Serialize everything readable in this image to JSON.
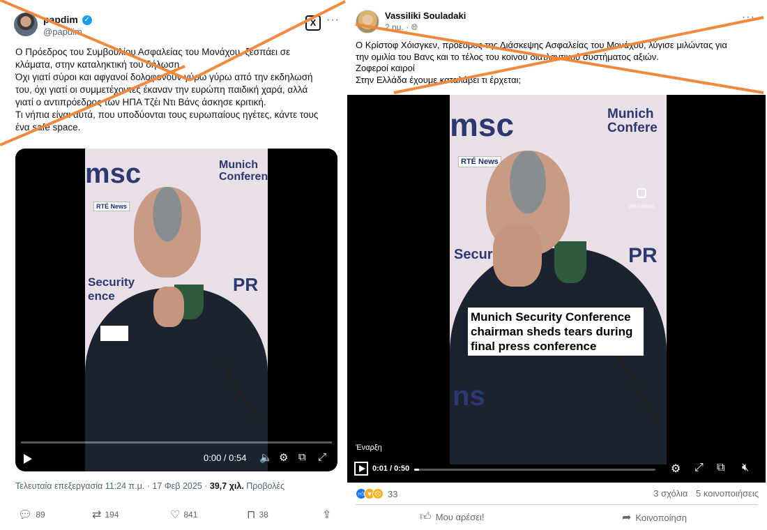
{
  "twitter_post": {
    "display_name": "papdim",
    "handle": "@papdim",
    "grok_label": "X",
    "more_label": "···",
    "text_lines": [
      "Ο Πρόεδρος του Συμβουλίου Ασφαλείας του Μονάχου, ξεσπάει σε",
      "κλάματα, στην καταληκτική του δήλωση.",
      "Όχι γιατί σύροι και αφγανοί δολοφονούν γύρω γύρω από την εκδηλωσή",
      "του, όχι γιατί οι συμμετέχοντες έκαναν την ευρώπη παιδική χαρά, αλλά",
      "γιατί ο αντιπρόεδρος των ΗΠΑ Τζέι Ντι Βάνς άσκησε κριτική.",
      "Τι νήπια είναι αυτά, που υποδύονται τους ευρωπαίους ηγέτες, κάντε τους",
      "ένα safe space."
    ],
    "video": {
      "frame": {
        "msc": "msc",
        "munich": "Munich",
        "conference": "Conferen",
        "rte": "RTÉ News",
        "security": "Security",
        "security2": "ence"
      },
      "progress": 0,
      "time_display": "0:00 / 0:54",
      "icons": [
        "volume-icon",
        "settings-icon",
        "pip-icon",
        "fullscreen-icon"
      ]
    },
    "meta": {
      "edited": "Τελευταία επεξεργασία 11:24 π.μ. · 17 Φεβ 2025 · ",
      "views": "39,7 χιλ.",
      "views_label": " Προβολές"
    },
    "actions": {
      "replies": "89",
      "reposts": "194",
      "likes": "841",
      "bookmarks": "38"
    },
    "accent": "#1d9bf0"
  },
  "facebook_post": {
    "author": "Vassiliki Souladaki",
    "time": "2 ημ. · ",
    "more_label": "···",
    "text_lines": [
      "Ο Κρίστοφ Χόισγκεν, πρόεδρος της Διάσκεψης Ασφαλείας του Μονάχου, λύγισε μιλώντας για",
      "την ομιλία του Βανς και το τέλος του κοινού διατλαντικού συστήματος αξιών.",
      "Ζοφεροί καιροί",
      "Στην Ελλάδα έχουμε καταλάβει τι έρχεται;"
    ],
    "video": {
      "frame": {
        "msc": "msc",
        "munich": "Munich",
        "conference": "Confere",
        "rte": "RTÉ News",
        "security": "Securit",
        "msc_bottom": "ns",
        "ig_handle": "@RTENEWS"
      },
      "caption_lines": [
        "Munich Security Conference",
        "chairman sheds tears during",
        "final press conference"
      ],
      "start_label": "Έναρξη",
      "time_display": "0:01 / 0:50",
      "progress": 0.02
    },
    "reactions_count": "33",
    "comments": "3 σχόλια",
    "shares": "5 κοινοποιήσεις",
    "like_label": "Μου αρέσει!",
    "share_label": "Κοινοποίηση",
    "accent": "#1877f2"
  },
  "crossout_color": "#f0883e"
}
